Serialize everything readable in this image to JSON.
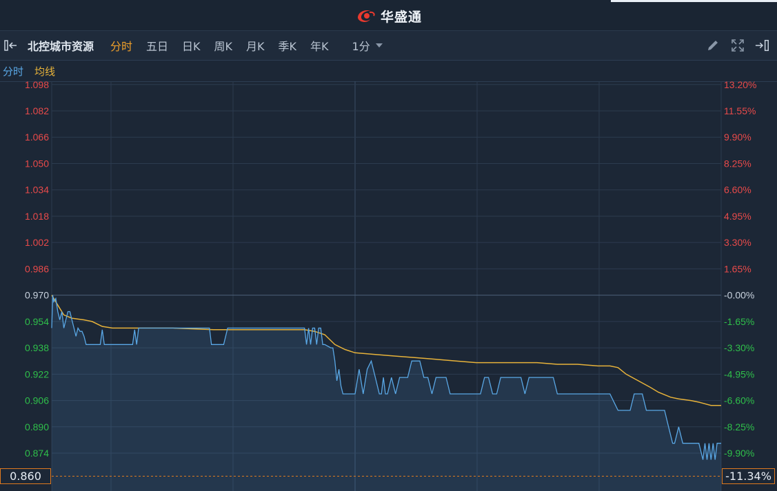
{
  "header": {
    "brand": "华盛通"
  },
  "toolbar": {
    "stock_name": "北控城市资源",
    "tabs": [
      "分时",
      "五日",
      "日K",
      "周K",
      "月K",
      "季K",
      "年K"
    ],
    "active_tab": "分时",
    "interval": "1分"
  },
  "legend": {
    "price": "分时",
    "avg": "均线"
  },
  "colors": {
    "price_line": "#5aa8e6",
    "avg_line": "#e8b33a",
    "up": "#e84a4a",
    "down": "#2fbf4a",
    "flat": "#c9d3df",
    "current_marker": "#e07a1f"
  },
  "current": {
    "price": "0.860",
    "pct": "-11.34%"
  },
  "chart_data": {
    "type": "line",
    "prev_close": 0.97,
    "ylim": [
      0.851,
      1.1
    ],
    "y_ticks_left": [
      "1.098",
      "1.082",
      "1.066",
      "1.050",
      "1.034",
      "1.018",
      "1.002",
      "0.986",
      "0.970",
      "0.954",
      "0.938",
      "0.922",
      "0.906",
      "0.890",
      "0.874"
    ],
    "y_ticks_right": [
      "13.20%",
      "11.55%",
      "9.90%",
      "8.25%",
      "6.60%",
      "4.95%",
      "3.30%",
      "1.65%",
      "-0.00%",
      "-1.65%",
      "-3.30%",
      "-4.95%",
      "-6.60%",
      "-8.25%",
      "-9.90%"
    ],
    "session_minutes": 331,
    "series": [
      {
        "key": "price",
        "points": [
          [
            0,
            0.95
          ],
          [
            0.5,
            0.97
          ],
          [
            1,
            0.966
          ],
          [
            2,
            0.968
          ],
          [
            3,
            0.96
          ],
          [
            4,
            0.955
          ],
          [
            5,
            0.96
          ],
          [
            6,
            0.95
          ],
          [
            7,
            0.955
          ],
          [
            8,
            0.96
          ],
          [
            9,
            0.96
          ],
          [
            10,
            0.955
          ],
          [
            11,
            0.95
          ],
          [
            12,
            0.945
          ],
          [
            13,
            0.95
          ],
          [
            14,
            0.948
          ],
          [
            15,
            0.948
          ],
          [
            16,
            0.945
          ],
          [
            17,
            0.94
          ],
          [
            18,
            0.94
          ],
          [
            20,
            0.94
          ],
          [
            24,
            0.94
          ],
          [
            25,
            0.949
          ],
          [
            26,
            0.94
          ],
          [
            30,
            0.94
          ],
          [
            40,
            0.94
          ],
          [
            41,
            0.949
          ],
          [
            42,
            0.94
          ],
          [
            43,
            0.95
          ],
          [
            46,
            0.95
          ],
          [
            50,
            0.95
          ],
          [
            60,
            0.95
          ],
          [
            70,
            0.95
          ],
          [
            78,
            0.95
          ],
          [
            79,
            0.94
          ],
          [
            85,
            0.94
          ],
          [
            87,
            0.95
          ],
          [
            100,
            0.95
          ],
          [
            120,
            0.95
          ],
          [
            125,
            0.95
          ],
          [
            126,
            0.94
          ],
          [
            127,
            0.95
          ],
          [
            128,
            0.94
          ],
          [
            129,
            0.95
          ],
          [
            130,
            0.95
          ],
          [
            131,
            0.94
          ],
          [
            132,
            0.95
          ],
          [
            133,
            0.95
          ],
          [
            134,
            0.94
          ],
          [
            135,
            0.94
          ],
          [
            138,
            0.938
          ],
          [
            139,
            0.938
          ],
          [
            140,
            0.93
          ],
          [
            141,
            0.918
          ],
          [
            142,
            0.925
          ],
          [
            143,
            0.915
          ],
          [
            144,
            0.91
          ],
          [
            147,
            0.91
          ],
          [
            150,
            0.91
          ],
          [
            152,
            0.925
          ],
          [
            154,
            0.91
          ],
          [
            156,
            0.925
          ],
          [
            158,
            0.93
          ],
          [
            160,
            0.92
          ],
          [
            162,
            0.91
          ],
          [
            163,
            0.91
          ],
          [
            164,
            0.92
          ],
          [
            165,
            0.91
          ],
          [
            166,
            0.91
          ],
          [
            168,
            0.92
          ],
          [
            170,
            0.91
          ],
          [
            172,
            0.92
          ],
          [
            174,
            0.92
          ],
          [
            176,
            0.92
          ],
          [
            178,
            0.93
          ],
          [
            182,
            0.93
          ],
          [
            184,
            0.92
          ],
          [
            186,
            0.92
          ],
          [
            188,
            0.91
          ],
          [
            190,
            0.92
          ],
          [
            192,
            0.92
          ],
          [
            195,
            0.92
          ],
          [
            197,
            0.91
          ],
          [
            200,
            0.91
          ],
          [
            210,
            0.91
          ],
          [
            212,
            0.91
          ],
          [
            214,
            0.92
          ],
          [
            216,
            0.92
          ],
          [
            218,
            0.91
          ],
          [
            220,
            0.91
          ],
          [
            222,
            0.92
          ],
          [
            230,
            0.92
          ],
          [
            232,
            0.92
          ],
          [
            234,
            0.91
          ],
          [
            236,
            0.92
          ],
          [
            238,
            0.92
          ],
          [
            240,
            0.92
          ],
          [
            246,
            0.92
          ],
          [
            248,
            0.92
          ],
          [
            250,
            0.91
          ],
          [
            256,
            0.91
          ],
          [
            270,
            0.91
          ],
          [
            276,
            0.91
          ],
          [
            280,
            0.9
          ],
          [
            286,
            0.9
          ],
          [
            288,
            0.91
          ],
          [
            292,
            0.91
          ],
          [
            294,
            0.9
          ],
          [
            300,
            0.9
          ],
          [
            303,
            0.9
          ],
          [
            305,
            0.89
          ],
          [
            307,
            0.88
          ],
          [
            308,
            0.88
          ],
          [
            310,
            0.89
          ],
          [
            312,
            0.88
          ],
          [
            314,
            0.88
          ],
          [
            320,
            0.88
          ],
          [
            322,
            0.87
          ],
          [
            323,
            0.88
          ],
          [
            324,
            0.87
          ],
          [
            325,
            0.88
          ],
          [
            326,
            0.87
          ],
          [
            327,
            0.88
          ],
          [
            328,
            0.87
          ],
          [
            329,
            0.88
          ],
          [
            331,
            0.88
          ]
        ]
      },
      {
        "key": "avg",
        "points": [
          [
            0,
            0.97
          ],
          [
            2,
            0.966
          ],
          [
            4,
            0.962
          ],
          [
            6,
            0.958
          ],
          [
            10,
            0.956
          ],
          [
            16,
            0.955
          ],
          [
            20,
            0.954
          ],
          [
            25,
            0.951
          ],
          [
            30,
            0.95
          ],
          [
            40,
            0.95
          ],
          [
            60,
            0.95
          ],
          [
            80,
            0.949
          ],
          [
            100,
            0.949
          ],
          [
            120,
            0.949
          ],
          [
            125,
            0.949
          ],
          [
            130,
            0.948
          ],
          [
            135,
            0.946
          ],
          [
            140,
            0.94
          ],
          [
            145,
            0.937
          ],
          [
            150,
            0.935
          ],
          [
            160,
            0.934
          ],
          [
            170,
            0.933
          ],
          [
            180,
            0.932
          ],
          [
            190,
            0.931
          ],
          [
            200,
            0.93
          ],
          [
            210,
            0.929
          ],
          [
            220,
            0.929
          ],
          [
            230,
            0.929
          ],
          [
            240,
            0.929
          ],
          [
            250,
            0.928
          ],
          [
            260,
            0.928
          ],
          [
            270,
            0.927
          ],
          [
            276,
            0.927
          ],
          [
            280,
            0.926
          ],
          [
            284,
            0.922
          ],
          [
            290,
            0.918
          ],
          [
            296,
            0.914
          ],
          [
            300,
            0.911
          ],
          [
            306,
            0.908
          ],
          [
            310,
            0.907
          ],
          [
            316,
            0.906
          ],
          [
            320,
            0.905
          ],
          [
            326,
            0.903
          ],
          [
            331,
            0.903
          ]
        ]
      }
    ],
    "legend": [
      "分时",
      "均线"
    ]
  }
}
